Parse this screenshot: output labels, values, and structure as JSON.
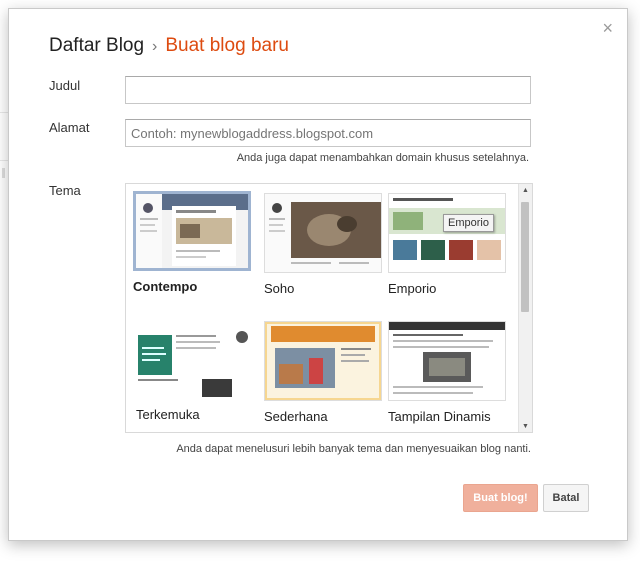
{
  "dialog": {
    "close_label": "×",
    "breadcrumb": {
      "parent": "Daftar Blog",
      "separator": "›",
      "current": "Buat blog baru"
    }
  },
  "form": {
    "title": {
      "label": "Judul",
      "value": ""
    },
    "address": {
      "label": "Alamat",
      "placeholder": "Contoh: mynewblogaddress.blogspot.com",
      "hint": "Anda juga dapat menambahkan domain khusus setelahnya."
    },
    "theme": {
      "label": "Tema",
      "selected": "Contempo",
      "items": [
        {
          "name": "Contempo"
        },
        {
          "name": "Soho"
        },
        {
          "name": "Emporio",
          "tooltip": "Emporio"
        },
        {
          "name": "Terkemuka"
        },
        {
          "name": "Sederhana"
        },
        {
          "name": "Tampilan Dinamis"
        }
      ],
      "footer_note": "Anda dapat menelusuri lebih banyak tema dan menyesuaikan blog nanti."
    }
  },
  "buttons": {
    "create": "Buat blog!",
    "cancel": "Batal"
  },
  "colors": {
    "accent": "#dd4b10",
    "create_button": "#f0b09c",
    "selected_border": "#9fb4d1"
  }
}
